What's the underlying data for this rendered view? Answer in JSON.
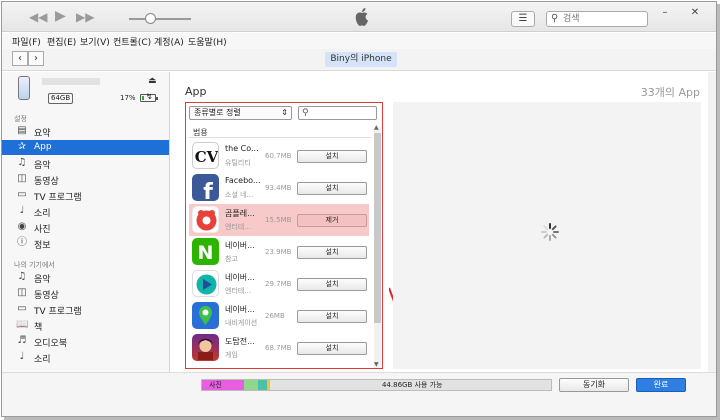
{
  "toolbar": {
    "rewind_icon": "rewind-icon",
    "play_icon": "play-icon",
    "fastforward_icon": "fast-forward-icon",
    "search_placeholder": "검색",
    "window_min": "–",
    "window_close": "✕"
  },
  "menu": [
    "파일(F)",
    "편집(E)",
    "보기(V)",
    "컨트롤(C)",
    "계정(A)",
    "도움말(H)"
  ],
  "nav": {
    "back": "‹",
    "forward": "›",
    "device_name": "Biny의 iPhone"
  },
  "device": {
    "capacity": "64GB",
    "battery": "17%",
    "battery_level": 0.17
  },
  "sidebar": {
    "settings_label": "설정",
    "settings_items": [
      {
        "label": "요약",
        "icon": "summary-icon",
        "active": false
      },
      {
        "label": "App",
        "icon": "app-store-icon",
        "active": true
      },
      {
        "label": "음악",
        "icon": "music-note-icon",
        "active": false
      },
      {
        "label": "동영상",
        "icon": "film-icon",
        "active": false
      },
      {
        "label": "TV 프로그램",
        "icon": "tv-icon",
        "active": false
      },
      {
        "label": "소리",
        "icon": "bell-icon",
        "active": false
      },
      {
        "label": "사진",
        "icon": "camera-icon",
        "active": false
      },
      {
        "label": "정보",
        "icon": "info-icon",
        "active": false
      }
    ],
    "ondevice_label": "나의 기기에서",
    "ondevice_items": [
      {
        "label": "음악",
        "icon": "music-note-icon"
      },
      {
        "label": "동영상",
        "icon": "film-icon"
      },
      {
        "label": "TV 프로그램",
        "icon": "tv-icon"
      },
      {
        "label": "책",
        "icon": "book-icon"
      },
      {
        "label": "오디오북",
        "icon": "audiobook-icon"
      },
      {
        "label": "소리",
        "icon": "bell-icon"
      }
    ]
  },
  "main": {
    "title": "App",
    "count": "33개의 App",
    "sort_label": "종류별로 정렬",
    "category": "범용",
    "apps": [
      {
        "name": "the Co...",
        "category": "유틸리티",
        "size": "60.7MB",
        "action": "설치",
        "selected": false,
        "icon": "cv-app-icon"
      },
      {
        "name": "Facebo...",
        "category": "소셜 네...",
        "size": "93.4MB",
        "action": "설치",
        "selected": false,
        "icon": "facebook-icon"
      },
      {
        "name": "곰플레...",
        "category": "엔터테...",
        "size": "15.5MB",
        "action": "제거",
        "selected": true,
        "icon": "gom-player-icon"
      },
      {
        "name": "네이버...",
        "category": "참고",
        "size": "23.9MB",
        "action": "설치",
        "selected": false,
        "icon": "naver-dictionary-icon"
      },
      {
        "name": "네이버...",
        "category": "엔터테...",
        "size": "29.7MB",
        "action": "설치",
        "selected": false,
        "icon": "naver-tv-icon"
      },
      {
        "name": "네이버...",
        "category": "내비게이션",
        "size": "26MB",
        "action": "설치",
        "selected": false,
        "icon": "naver-map-icon"
      },
      {
        "name": "도탑전...",
        "category": "게임",
        "size": "68.7MB",
        "action": "설치",
        "selected": false,
        "icon": "game-icon"
      }
    ]
  },
  "storage": {
    "photos_label": "사진",
    "free_label": "44.86GB 사용 가능",
    "segments": [
      {
        "color": "#e85ee0",
        "fraction": 0.12
      },
      {
        "color": "#8ed88a",
        "fraction": 0.04
      },
      {
        "color": "#4bc1a8",
        "fraction": 0.025
      },
      {
        "color": "#f0c23a",
        "fraction": 0.01
      }
    ]
  },
  "buttons": {
    "sync": "동기화",
    "done": "완료"
  },
  "colors": {
    "accent": "#1e70d8",
    "highlight": "#e03a3a"
  }
}
